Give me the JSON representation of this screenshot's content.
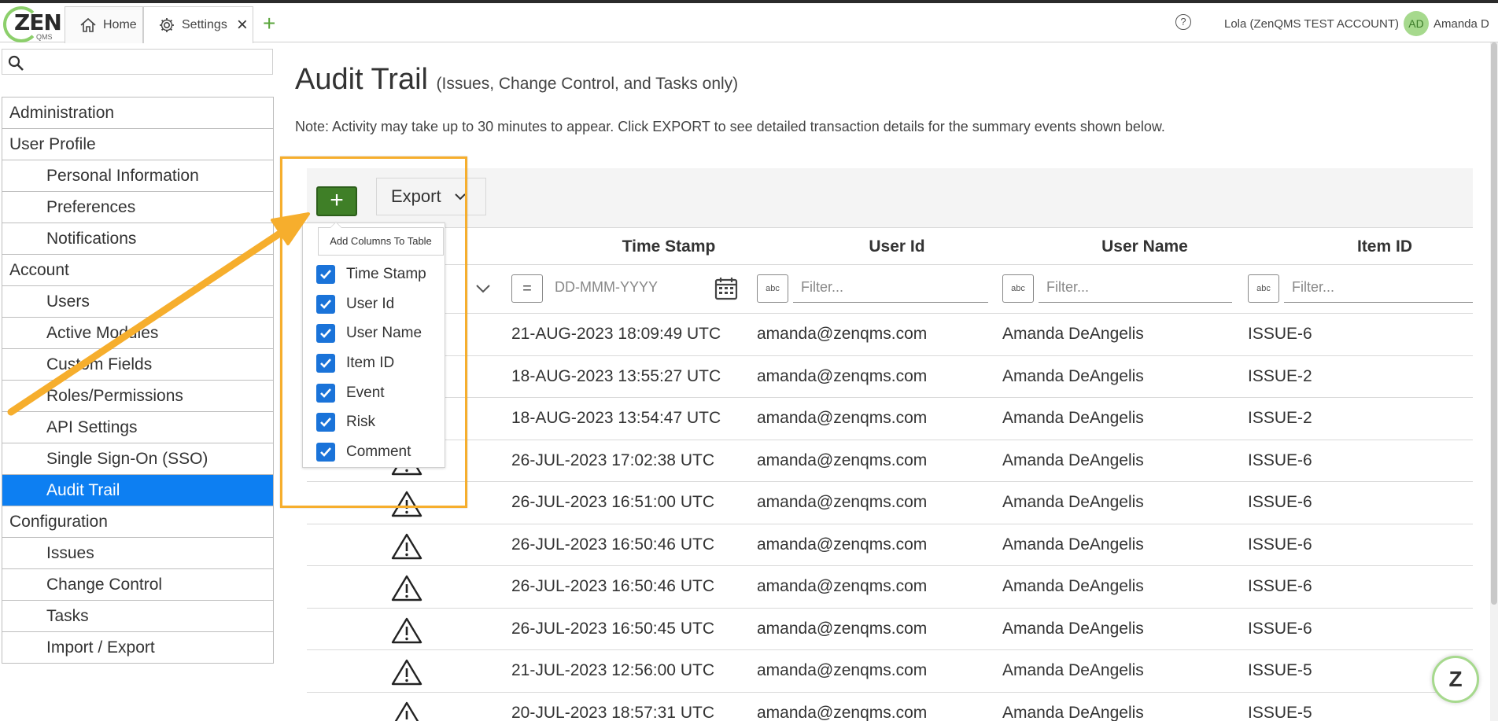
{
  "header": {
    "logo_text": "ZEN",
    "logo_sub": "QMS",
    "tabs": [
      {
        "label": "Home",
        "icon": "home-icon"
      },
      {
        "label": "Settings",
        "icon": "gear-icon"
      }
    ],
    "add_tab": "+",
    "help": "?",
    "account": "Lola (ZenQMS TEST ACCOUNT)",
    "avatar_initials": "AD",
    "user_name": "Amanda D"
  },
  "sidebar": {
    "items": [
      {
        "label": "Administration",
        "type": "heading"
      },
      {
        "label": "User Profile",
        "type": "heading"
      },
      {
        "label": "Personal Information",
        "type": "sub"
      },
      {
        "label": "Preferences",
        "type": "sub"
      },
      {
        "label": "Notifications",
        "type": "sub"
      },
      {
        "label": "Account",
        "type": "heading"
      },
      {
        "label": "Users",
        "type": "sub"
      },
      {
        "label": "Active Modules",
        "type": "sub"
      },
      {
        "label": "Custom Fields",
        "type": "sub"
      },
      {
        "label": "Roles/Permissions",
        "type": "sub"
      },
      {
        "label": "API Settings",
        "type": "sub"
      },
      {
        "label": "Single Sign-On (SSO)",
        "type": "sub"
      },
      {
        "label": "Audit Trail",
        "type": "sub",
        "active": true
      },
      {
        "label": "Configuration",
        "type": "heading"
      },
      {
        "label": "Issues",
        "type": "sub"
      },
      {
        "label": "Change Control",
        "type": "sub"
      },
      {
        "label": "Tasks",
        "type": "sub"
      },
      {
        "label": "Import / Export",
        "type": "sub"
      }
    ]
  },
  "main": {
    "title": "Audit Trail",
    "subtitle": "(Issues, Change Control, and Tasks only)",
    "note": "Note: Activity may take up to 30 minutes to appear. Click EXPORT to see detailed transaction details for the summary events shown below.",
    "add_label": "+",
    "export_label": "Export",
    "tooltip": "Add Columns To Table",
    "columns": [
      "Time Stamp",
      "User Id",
      "User Name",
      "Item ID"
    ],
    "date_placeholder": "DD-MMM-YYYY",
    "filter_placeholder": "Filter...",
    "equals_symbol": "=",
    "text_filter_symbol": "abc",
    "column_options": [
      "Time Stamp",
      "User Id",
      "User Name",
      "Item ID",
      "Event",
      "Risk",
      "Comment"
    ],
    "rows": [
      {
        "time": "21-AUG-2023 18:09:49 UTC",
        "user_id": "amanda@zenqms.com",
        "user_name": "Amanda DeAngelis",
        "item": "ISSUE-6"
      },
      {
        "time": "18-AUG-2023 13:55:27 UTC",
        "user_id": "amanda@zenqms.com",
        "user_name": "Amanda DeAngelis",
        "item": "ISSUE-2"
      },
      {
        "time": "18-AUG-2023 13:54:47 UTC",
        "user_id": "amanda@zenqms.com",
        "user_name": "Amanda DeAngelis",
        "item": "ISSUE-2"
      },
      {
        "time": "26-JUL-2023 17:02:38 UTC",
        "user_id": "amanda@zenqms.com",
        "user_name": "Amanda DeAngelis",
        "item": "ISSUE-6"
      },
      {
        "time": "26-JUL-2023 16:51:00 UTC",
        "user_id": "amanda@zenqms.com",
        "user_name": "Amanda DeAngelis",
        "item": "ISSUE-6"
      },
      {
        "time": "26-JUL-2023 16:50:46 UTC",
        "user_id": "amanda@zenqms.com",
        "user_name": "Amanda DeAngelis",
        "item": "ISSUE-6"
      },
      {
        "time": "26-JUL-2023 16:50:46 UTC",
        "user_id": "amanda@zenqms.com",
        "user_name": "Amanda DeAngelis",
        "item": "ISSUE-6"
      },
      {
        "time": "26-JUL-2023 16:50:45 UTC",
        "user_id": "amanda@zenqms.com",
        "user_name": "Amanda DeAngelis",
        "item": "ISSUE-6"
      },
      {
        "time": "21-JUL-2023 12:56:00 UTC",
        "user_id": "amanda@zenqms.com",
        "user_name": "Amanda DeAngelis",
        "item": "ISSUE-5"
      },
      {
        "time": "20-JUL-2023 18:57:31 UTC",
        "user_id": "amanda@zenqms.com",
        "user_name": "Amanda DeAngelis",
        "item": "ISSUE-5"
      }
    ],
    "fab_letter": "Z"
  },
  "colors": {
    "accent_blue": "#0d7ff2",
    "brand_green": "#3f7f27",
    "highlight_orange": "#f6ae2d"
  }
}
